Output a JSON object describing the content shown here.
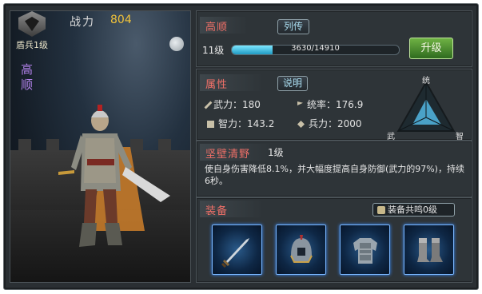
{
  "hero": {
    "rank_label": "盾兵1级",
    "power_label": "战力",
    "power_value": "804",
    "name": "高顺"
  },
  "info": {
    "name": "高顺",
    "bio_button": "列传",
    "level": "11级",
    "xp_text": "3630/14910",
    "xp_fraction": 0.2435,
    "upgrade_button": "升级"
  },
  "attributes": {
    "title": "属性",
    "explain_button": "说明",
    "stats": [
      {
        "label": "武力",
        "value": "180"
      },
      {
        "label": "统率",
        "value": "176.9"
      },
      {
        "label": "智力",
        "value": "143.2"
      },
      {
        "label": "兵力",
        "value": "2000"
      }
    ],
    "triangle": {
      "top": "统",
      "left": "武",
      "right": "智"
    }
  },
  "skill": {
    "name": "坚壁清野",
    "level": "1级",
    "description": "使自身伤害降低8.1%，并大幅度提高自身防御(武力的97%)，持续6秒。"
  },
  "equipment": {
    "title": "装备",
    "resonance_button": "装备共鸣0级",
    "slots": [
      {
        "icon": "sword-icon"
      },
      {
        "icon": "helmet-icon"
      },
      {
        "icon": "armor-icon"
      },
      {
        "icon": "boots-icon"
      }
    ]
  },
  "colors": {
    "accent_red": "#f07068",
    "power_gold": "#f0c23a",
    "name_purple": "#b080e8",
    "xp_cyan": "#1f9ac4",
    "upgrade_green": "#4e9a33"
  }
}
